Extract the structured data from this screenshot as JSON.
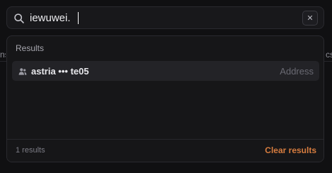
{
  "background": {
    "edge_left_text": "ns",
    "edge_right_text": "cs"
  },
  "search": {
    "query": "iewuwei.",
    "icon": "search-icon",
    "clear_icon": "close-icon",
    "clear_glyph": "✕"
  },
  "results_panel": {
    "section_title": "Results",
    "items": [
      {
        "icon": "user-group-icon",
        "name": "astria ••• te05",
        "type": "Address"
      }
    ],
    "count_text": "1 results",
    "clear_label": "Clear results"
  },
  "colors": {
    "background": "#101012",
    "panel": "#161618",
    "row_highlight": "#232327",
    "accent": "#d67c3f",
    "text_primary": "#e8e8ec",
    "text_muted": "#6a6a73"
  }
}
